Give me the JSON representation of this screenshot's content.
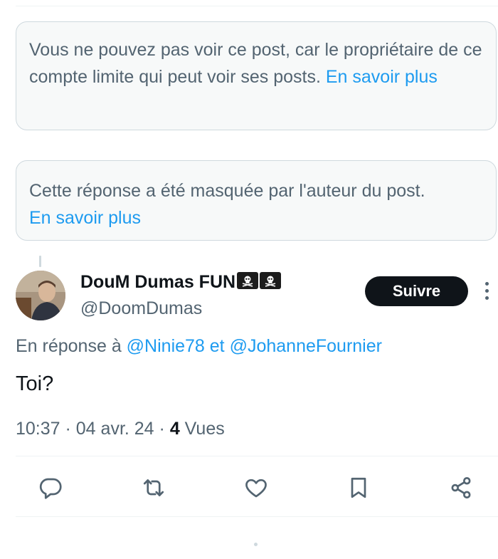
{
  "notices": [
    {
      "text": "Vous ne pouvez pas voir ce post, car le propriétaire de ce compte limite qui peut voir ses posts. ",
      "link": "En savoir plus"
    },
    {
      "text": "Cette réponse a été masquée par l'auteur du post. ",
      "link": "En savoir plus"
    }
  ],
  "post": {
    "display_name": "DouM Dumas FUN",
    "name_emojis": [
      "pirate-flag",
      "pirate-flag"
    ],
    "handle": "@DoomDumas",
    "follow_label": "Suivre",
    "reply_prefix": "En réponse à ",
    "mention_1": "@Ninie78",
    "reply_joiner": " et ",
    "mention_2": "@JohanneFournier",
    "text": "Toi?",
    "time": "10:37",
    "separator": " · ",
    "date": "04 avr. 24",
    "views_count": "4",
    "views_label": " Vues"
  },
  "actions": [
    "reply-icon",
    "repost-icon",
    "like-icon",
    "bookmark-icon",
    "share-icon"
  ],
  "colors": {
    "link": "#1d9bf0",
    "text_primary": "#0f1419",
    "text_secondary": "#536471",
    "button_bg": "#0f1419"
  }
}
